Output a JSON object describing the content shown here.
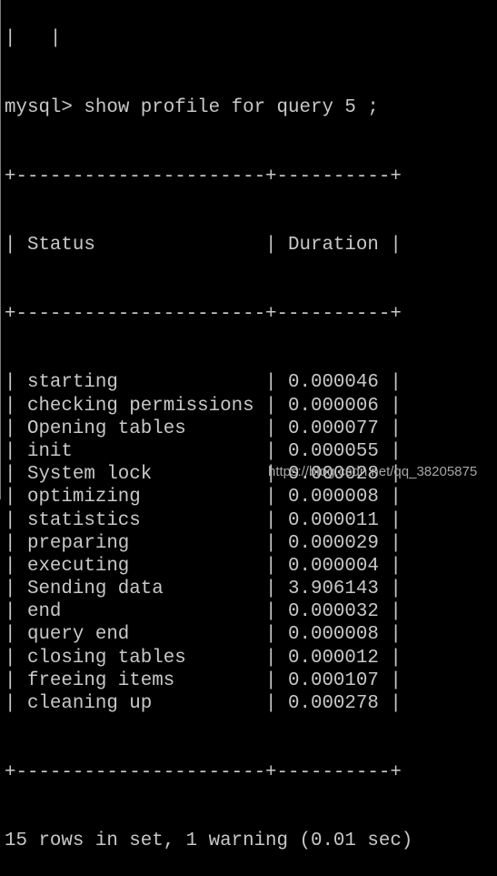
{
  "terminal": {
    "partial_top_line": "|   |",
    "prompt": "mysql>",
    "command": "show profile for query 5 ;",
    "table": {
      "columns": [
        "Status",
        "Duration"
      ],
      "rows": [
        {
          "status": "starting",
          "duration": "0.000046"
        },
        {
          "status": "checking permissions",
          "duration": "0.000006"
        },
        {
          "status": "Opening tables",
          "duration": "0.000077"
        },
        {
          "status": "init",
          "duration": "0.000055"
        },
        {
          "status": "System lock",
          "duration": "0.000028"
        },
        {
          "status": "optimizing",
          "duration": "0.000008"
        },
        {
          "status": "statistics",
          "duration": "0.000011"
        },
        {
          "status": "preparing",
          "duration": "0.000029"
        },
        {
          "status": "executing",
          "duration": "0.000004"
        },
        {
          "status": "Sending data",
          "duration": "3.906143"
        },
        {
          "status": "end",
          "duration": "0.000032"
        },
        {
          "status": "query end",
          "duration": "0.000008"
        },
        {
          "status": "closing tables",
          "duration": "0.000012"
        },
        {
          "status": "freeing items",
          "duration": "0.000107"
        },
        {
          "status": "cleaning up",
          "duration": "0.000278"
        }
      ]
    },
    "result_summary": "15 rows in set, 1 warning (0.01 sec)"
  },
  "watermark": "https://blog.csdn.net/qq_38205875"
}
